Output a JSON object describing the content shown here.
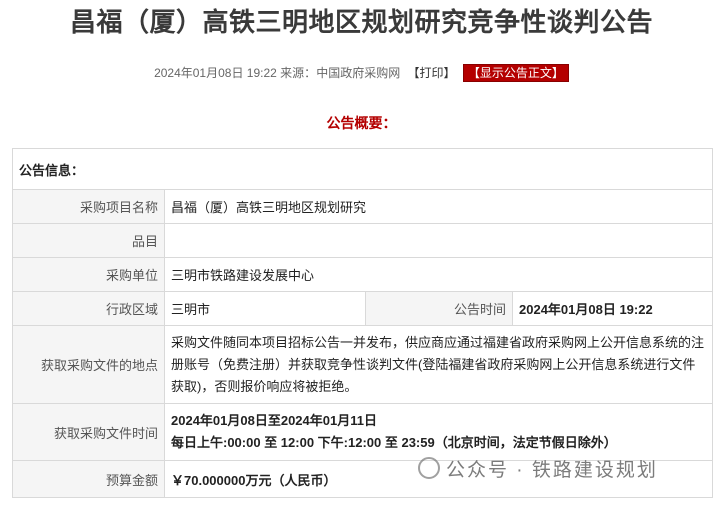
{
  "title": "昌福（厦）高铁三明地区规划研究竞争性谈判公告",
  "meta": {
    "datetime": "2024年01月08日 19:22",
    "source_label": "来源：",
    "source": "中国政府采购网",
    "print_label": "【打印】",
    "show_full_label": "【显示公告正文】"
  },
  "summary_heading": "公告概要：",
  "info_heading": "公告信息：",
  "rows": {
    "project_name": {
      "label": "采购项目名称",
      "value": "昌福（厦）高铁三明地区规划研究"
    },
    "item": {
      "label": "品目",
      "value": ""
    },
    "purchaser": {
      "label": "采购单位",
      "value": "三明市铁路建设发展中心"
    },
    "region": {
      "label": "行政区域",
      "value": "三明市"
    },
    "publish_time": {
      "label": "公告时间",
      "value": "2024年01月08日 19:22"
    },
    "doc_location": {
      "label": "获取采购文件的地点",
      "value": "采购文件随同本项目招标公告一并发布，供应商应通过福建省政府采购网上公开信息系统的注册账号（免费注册）并获取竞争性谈判文件(登陆福建省政府采购网上公开信息系统进行文件获取)，否则报价响应将被拒绝。"
    },
    "doc_time": {
      "label": "获取采购文件时间",
      "line1": "2024年01月08日至2024年01月11日",
      "line2": "每日上午:00:00 至 12:00  下午:12:00 至 23:59（北京时间，法定节假日除外）"
    },
    "budget": {
      "label": "预算金额",
      "value": "￥70.000000万元（人民币）"
    }
  },
  "watermark": "公众号 · 铁路建设规划"
}
